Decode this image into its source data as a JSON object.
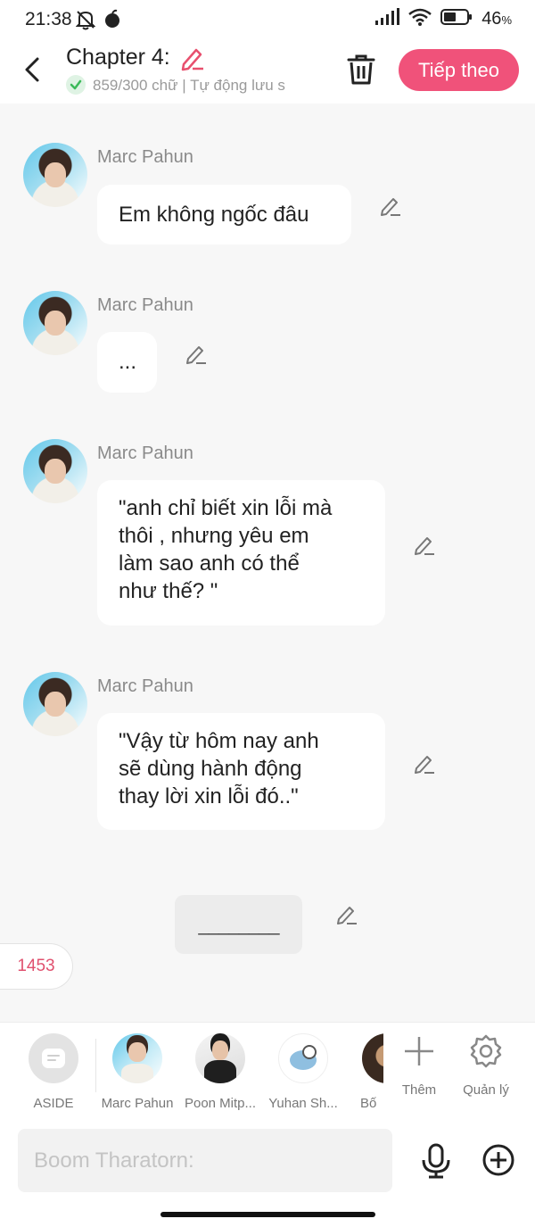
{
  "status_bar": {
    "time": "21:38",
    "battery": "46",
    "battery_unit": "%"
  },
  "header": {
    "chapter_title": "Chapter 4:",
    "status_text": "859/300 chữ | Tự động lưu s",
    "next_label": "Tiếp theo"
  },
  "messages": [
    {
      "sender": "Marc Pahun",
      "lines": [
        "Em không ngốc đâu"
      ]
    },
    {
      "sender": "Marc Pahun",
      "lines": [
        "..."
      ]
    },
    {
      "sender": "Marc Pahun",
      "lines": [
        "\"anh chỉ biết xin lỗi mà",
        "thôi , nhưng yêu em",
        "làm sao anh có thể",
        "như thế? \""
      ]
    },
    {
      "sender": "Marc Pahun",
      "lines": [
        "\"Vậy từ hôm nay anh",
        "sẽ dùng hành động",
        "thay lời xin lỗi đó..\""
      ]
    }
  ],
  "divider_text": "________",
  "word_count": "1453",
  "character_bar": {
    "items": [
      {
        "label": "ASIDE"
      },
      {
        "label": "Marc Pahun"
      },
      {
        "label": "Poon Mitp..."
      },
      {
        "label": "Yuhan Sh..."
      },
      {
        "label": "Bố"
      }
    ],
    "add_label": "Thêm",
    "manage_label": "Quản lý"
  },
  "composer": {
    "placeholder": "Boom Tharatorn:"
  },
  "colors": {
    "accent": "#f0527a",
    "word_count": "#e0506e",
    "check": "#3cba5a"
  }
}
